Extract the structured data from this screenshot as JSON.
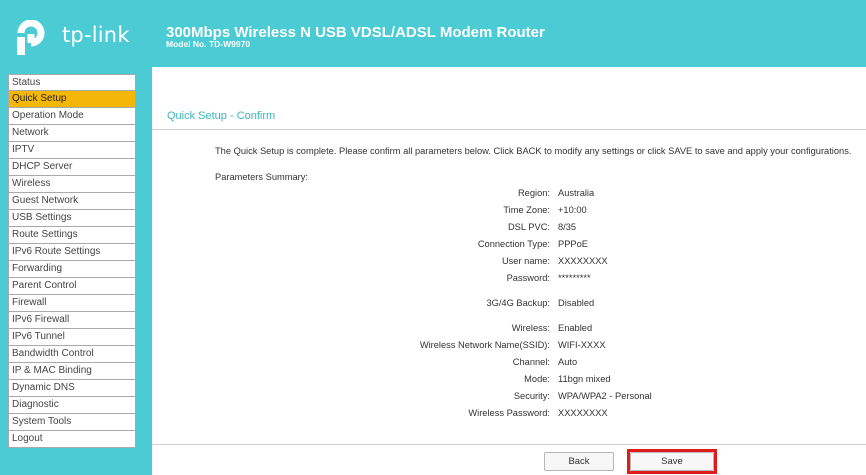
{
  "header": {
    "logo_text": "tp-link",
    "product_title": "300Mbps Wireless N USB VDSL/ADSL Modem Router",
    "model_no": "Model No. TD-W9970"
  },
  "sidebar": {
    "items": [
      {
        "label": "Status",
        "active": false
      },
      {
        "label": "Quick Setup",
        "active": true
      },
      {
        "label": "Operation Mode",
        "active": false
      },
      {
        "label": "Network",
        "active": false
      },
      {
        "label": "IPTV",
        "active": false
      },
      {
        "label": "DHCP Server",
        "active": false
      },
      {
        "label": "Wireless",
        "active": false
      },
      {
        "label": "Guest Network",
        "active": false
      },
      {
        "label": "USB Settings",
        "active": false
      },
      {
        "label": "Route Settings",
        "active": false
      },
      {
        "label": "IPv6 Route Settings",
        "active": false
      },
      {
        "label": "Forwarding",
        "active": false
      },
      {
        "label": "Parent Control",
        "active": false
      },
      {
        "label": "Firewall",
        "active": false
      },
      {
        "label": "IPv6 Firewall",
        "active": false
      },
      {
        "label": "IPv6 Tunnel",
        "active": false
      },
      {
        "label": "Bandwidth Control",
        "active": false
      },
      {
        "label": "IP & MAC Binding",
        "active": false
      },
      {
        "label": "Dynamic DNS",
        "active": false
      },
      {
        "label": "Diagnostic",
        "active": false
      },
      {
        "label": "System Tools",
        "active": false
      },
      {
        "label": "Logout",
        "active": false
      }
    ]
  },
  "main": {
    "page_title": "Quick Setup - Confirm",
    "intro": "The Quick Setup is complete. Please confirm all parameters below. Click BACK to modify any settings or click SAVE to save and apply your configurations.",
    "summary_title": "Parameters Summary:",
    "params": [
      {
        "label": "Region:",
        "value": "Australia"
      },
      {
        "label": "Time Zone:",
        "value": "+10:00"
      },
      {
        "label": "DSL PVC:",
        "value": "8/35"
      },
      {
        "label": "Connection Type:",
        "value": "PPPoE"
      },
      {
        "label": "User name:",
        "value": "XXXXXXXX"
      },
      {
        "label": "Password:",
        "value": "*********"
      },
      {
        "label": "3G/4G Backup:",
        "value": "Disabled"
      },
      {
        "label": "Wireless:",
        "value": "Enabled"
      },
      {
        "label": "Wireless Network Name(SSID):",
        "value": "WIFI-XXXX"
      },
      {
        "label": "Channel:",
        "value": "Auto"
      },
      {
        "label": "Mode:",
        "value": "11bgn mixed"
      },
      {
        "label": "Security:",
        "value": "WPA/WPA2 - Personal"
      },
      {
        "label": "Wireless Password:",
        "value": "XXXXXXXX"
      }
    ],
    "buttons": {
      "back_label": "Back",
      "save_label": "Save"
    }
  },
  "colors": {
    "brand": "#4bcbd3",
    "active_menu": "#f4b707",
    "title_text": "#3ab5c0",
    "highlight": "#e01b1b"
  }
}
